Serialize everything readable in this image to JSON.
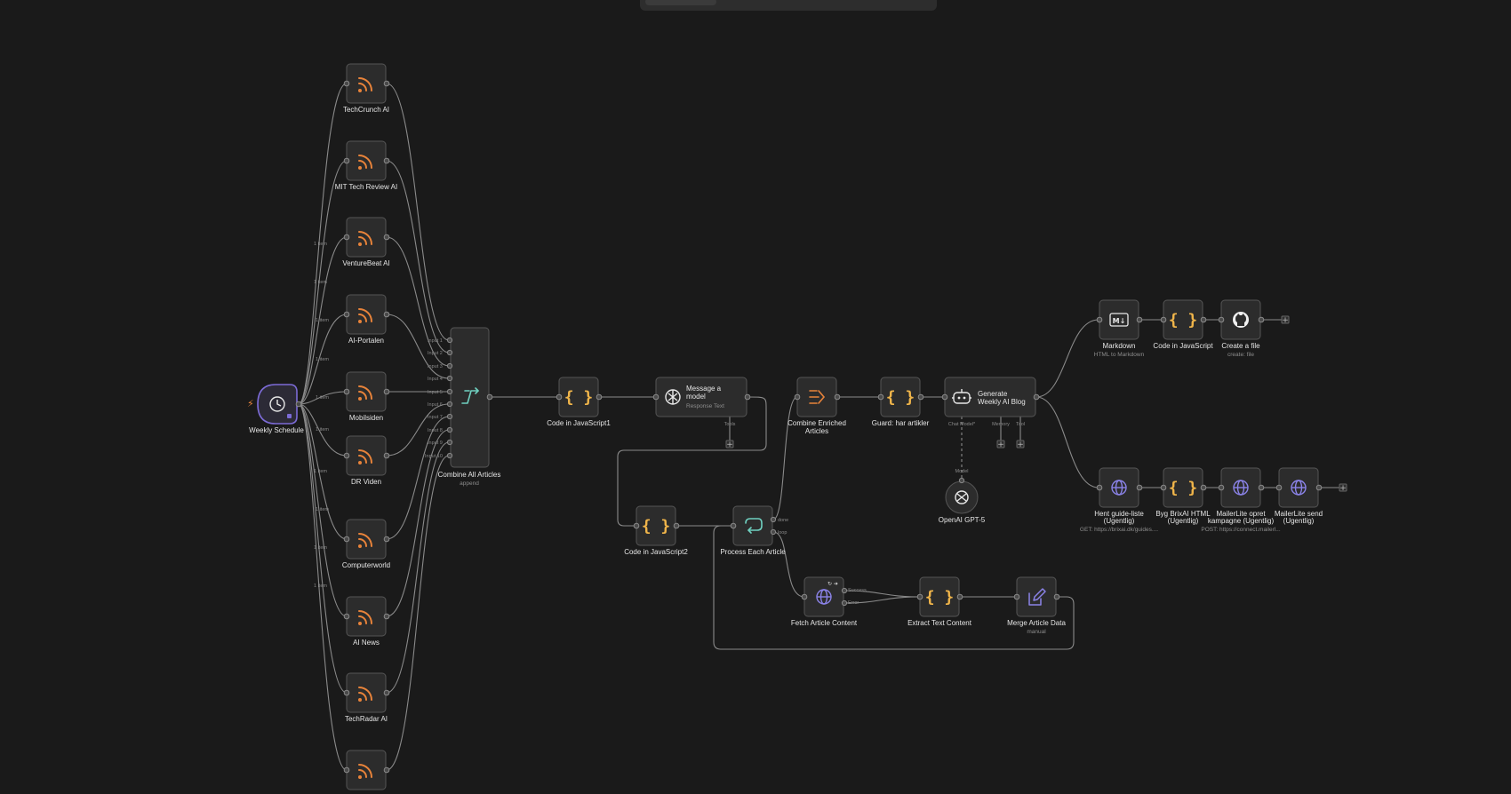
{
  "app": {
    "canvas_theme": "dark",
    "colors": {
      "background": "#1a1a1a",
      "node": "#2c2c2c",
      "rss": "#e8833a",
      "code": "#f0b54a",
      "http": "#8b83e8",
      "loop": "#6fd0c0",
      "trigger_border": "#7c6bd6"
    }
  },
  "trigger": {
    "label": "Weekly Schedule",
    "icon": "clock-icon"
  },
  "feeds": [
    {
      "label": "TechCrunch AI",
      "icon": "rss-icon"
    },
    {
      "label": "MIT Tech Review AI",
      "icon": "rss-icon"
    },
    {
      "label": "VentureBeat AI",
      "icon": "rss-icon"
    },
    {
      "label": "AI-Portalen",
      "icon": "rss-icon"
    },
    {
      "label": "Mobilsiden",
      "icon": "rss-icon"
    },
    {
      "label": "DR Viden",
      "icon": "rss-icon"
    },
    {
      "label": "Computerworld",
      "icon": "rss-icon"
    },
    {
      "label": "AI News",
      "icon": "rss-icon"
    },
    {
      "label": "TechRadar AI",
      "icon": "rss-icon"
    },
    {
      "label": "",
      "icon": "rss-icon"
    }
  ],
  "edge_item_label": "1 item",
  "merge": {
    "label": "Combine All Articles",
    "sublabel": "append",
    "inputs": [
      "Input 1",
      "Input 2",
      "Input 3",
      "Input 4",
      "Input 5",
      "Input 6",
      "Input 7",
      "Input 8",
      "Input 9",
      "Input 10"
    ]
  },
  "nodes": {
    "code1": {
      "label": "Code in JavaScript1"
    },
    "message": {
      "label_line1": "Message a",
      "label_line2": "model",
      "sublabel": "Response Text",
      "port_label": "Tools"
    },
    "code2": {
      "label": "Code in JavaScript2"
    },
    "process": {
      "label": "Process Each Article",
      "out_done": "done",
      "out_loop": "loop"
    },
    "fetch": {
      "label": "Fetch Article Content",
      "out_success": "Success",
      "out_error": "Error"
    },
    "extract": {
      "label": "Extract Text Content"
    },
    "mergeData": {
      "label": "Merge Article Data",
      "sublabel": "manual"
    },
    "combineEnriched": {
      "label_line1": "Combine Enriched",
      "label_line2": "Articles"
    },
    "guard": {
      "label": "Guard: har artikler"
    },
    "agent": {
      "label_line1": "Generate",
      "label_line2": "Weekly AI Blog",
      "port_chat": "Chat Model*",
      "port_memory": "Memory",
      "port_tool": "Tool"
    },
    "openai": {
      "label": "OpenAI GPT-5",
      "edge_label": "Model"
    },
    "markdown": {
      "label": "Markdown",
      "sublabel": "HTML to Markdown"
    },
    "codeJs": {
      "label": "Code in JavaScript"
    },
    "createFile": {
      "label": "Create a file",
      "sublabel": "create: file"
    },
    "hent": {
      "label_line1": "Hent guide-liste",
      "label_line2": "(Ugentlig)",
      "sublabel": "GET: https://brixai.dk/guides...."
    },
    "byg": {
      "label_line1": "Byg BrixAI HTML",
      "label_line2": "(Ugentlig)"
    },
    "mlCreate": {
      "label_line1": "MailerLite opret",
      "label_line2": "kampagne (Ugentlig)",
      "sublabel": "POST: https://connect.mailerl..."
    },
    "mlSend": {
      "label_line1": "MailerLite send",
      "label_line2": "(Ugentlig)"
    }
  },
  "plus": "+"
}
